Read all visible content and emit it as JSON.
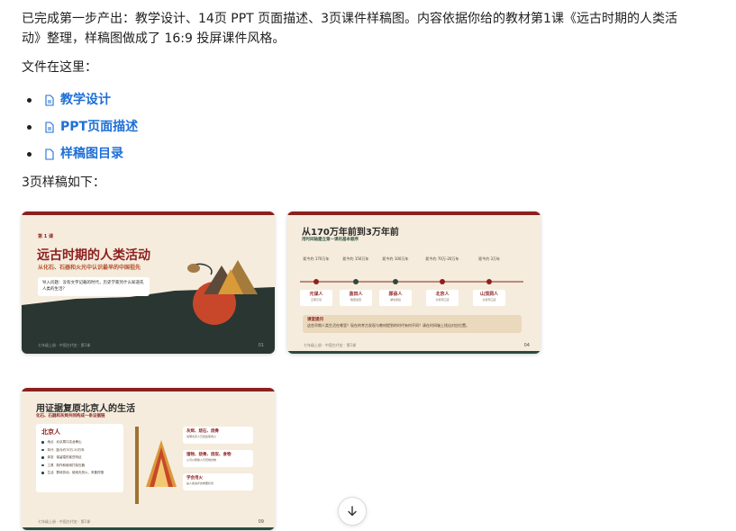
{
  "message": {
    "paragraph1": "已完成第一步产出：教学设计、14页 PPT 页面描述、3页课件样稿图。内容依据你给的教材第1课《远古时期的人类活动》整理，样稿图做成了 16:9 投屏课件风格。",
    "files_intro": "文件在这里：",
    "files": [
      {
        "label": "教学设计",
        "icon": "document-icon"
      },
      {
        "label": "PPT页面描述",
        "icon": "document-icon"
      },
      {
        "label": "样稿图目录",
        "icon": "file-icon"
      }
    ],
    "samples_intro": "3页样稿如下："
  },
  "slides": {
    "s1": {
      "lesson": "第 1 课",
      "title": "远古时期的人类活动",
      "subtitle": "从化石、石器和火光中认识最早的中国祖先",
      "question": "导入问题：没有文字记载的时代，历史学家凭什么知道先人类的生活？",
      "footer": "七年级上册 · 中国古代史 · 第1课",
      "page": "01"
    },
    "s2": {
      "title": "从170万年前到3万年前",
      "subtitle": "用时间轴建立第一课的基本顺序",
      "timeline": [
        {
          "time": "距今约 170万年",
          "name": "元谋人",
          "desc": "云南元谋"
        },
        {
          "time": "距今约 150万年",
          "name": "蓝田人",
          "desc": "陕西蓝田"
        },
        {
          "time": "距今约 100万年",
          "name": "郧县人",
          "desc": "湖北郧县"
        },
        {
          "time": "距今约 70万-20万年",
          "name": "北京人",
          "desc": "北京周口店"
        },
        {
          "time": "距今约 3万年",
          "name": "山顶洞人",
          "desc": "北京周口店"
        }
      ],
      "note_title": "课堂提问",
      "note_text": "这些早期人类生活在哪里？现在的考古发现与教材提到的时代有何不同？请在时间轴上找出对应位置。",
      "footer": "七年级上册 · 中国古代史 · 第1课",
      "page": "04"
    },
    "s3": {
      "title": "用证据复原北京人的生活",
      "subtitle": "化石、石器和灰烬共同构成一条证据链",
      "card_title": "北京人",
      "facts": [
        {
          "k": "地点",
          "v": "北京周口店龙骨山"
        },
        {
          "k": "年代",
          "v": "距今约70万-20万年"
        },
        {
          "k": "体态",
          "v": "保留猿的某些特征"
        },
        {
          "k": "工具",
          "v": "制作和使用打制石器"
        },
        {
          "k": "生活",
          "v": "群体劳动、使用天然火、采集狩猎"
        }
      ],
      "evidence": [
        {
          "title": "灰烬、烧石、烧骨",
          "text": "说明北京人已经会使用火"
        },
        {
          "title": "猎物、烧骨、烧炭、食物",
          "text": "火可以帮助人们烧烤食物"
        },
        {
          "title": "学会用火",
          "text": "是人类进步的重要标志"
        }
      ],
      "footer": "七年级上册 · 中国古代史 · 第1课",
      "page": "09"
    }
  },
  "colors": {
    "link": "#1f6fd6",
    "slide_bg": "#f5ecdd",
    "accent_red": "#8c1f1f",
    "dark_green": "#2a3631"
  }
}
